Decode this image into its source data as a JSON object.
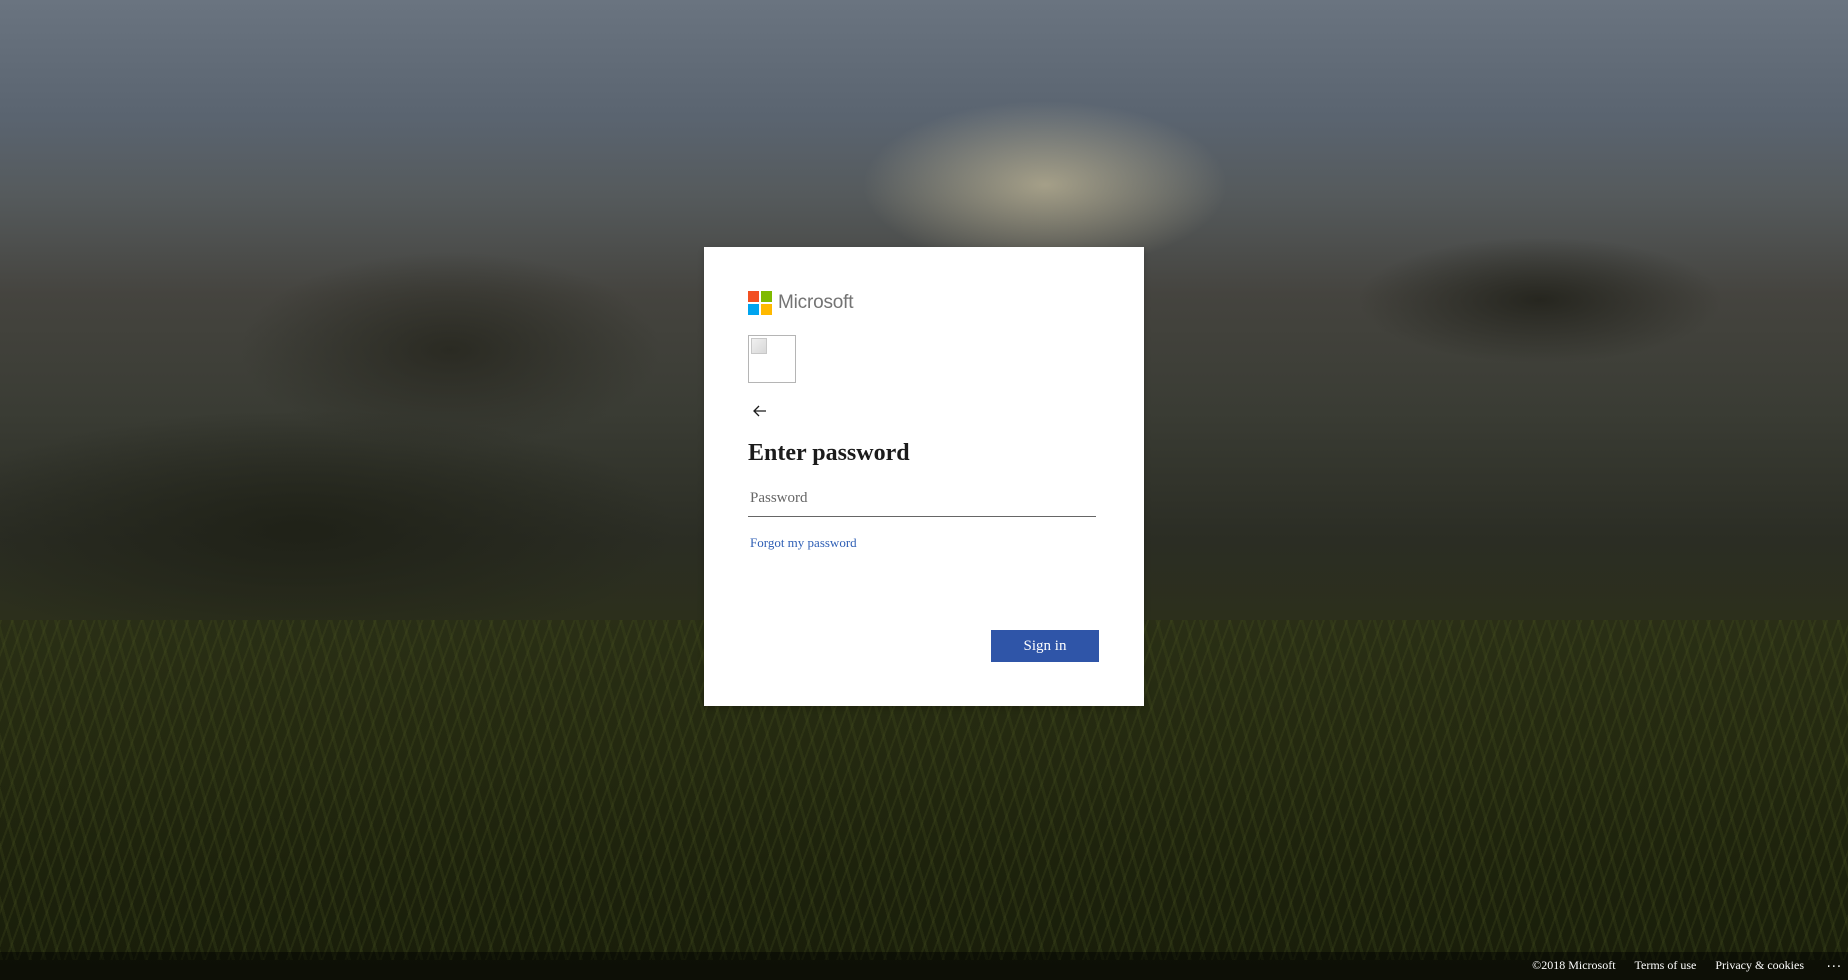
{
  "brand": {
    "name": "Microsoft",
    "logo_colors": [
      "#f25022",
      "#7fba00",
      "#00a4ef",
      "#ffb900"
    ]
  },
  "card": {
    "back_icon": "arrow-left-icon",
    "title": "Enter password",
    "password_placeholder": "Password",
    "password_value": "",
    "forgot_link": "Forgot my password",
    "signin_label": "Sign in",
    "signin_color": "#2f55a8",
    "link_color": "#2f5fb5"
  },
  "footer": {
    "copyright": "©2018 Microsoft",
    "terms": "Terms of use",
    "privacy": "Privacy & cookies",
    "more": "..."
  }
}
